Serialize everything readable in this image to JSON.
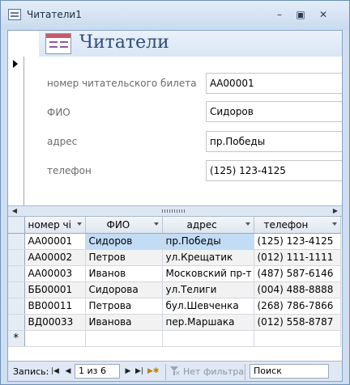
{
  "window": {
    "title": "Читатели1",
    "controls": {
      "minimize": "–",
      "restore": "▣",
      "close": "✕"
    }
  },
  "form": {
    "title": "Читатели",
    "fields": [
      {
        "label": "номер читательского билета",
        "value": "АА00001"
      },
      {
        "label": "ФИО",
        "value": "Сидоров"
      },
      {
        "label": "адрес",
        "value": "пр.Победы"
      },
      {
        "label": "телефон",
        "value": "(125) 123-4125"
      }
    ]
  },
  "datasheet": {
    "columns": [
      "номер чі",
      "ФИО",
      "адрес",
      "телефон"
    ],
    "rows": [
      [
        "АА00001",
        "Сидоров",
        "пр.Победы",
        "(125) 123-4125"
      ],
      [
        "АА00002",
        "Петров",
        "ул.Крещатик",
        "(012) 111-1111"
      ],
      [
        "АА00003",
        "Иванов",
        "Московский пр-т",
        "(487) 587-6146"
      ],
      [
        "ББ00001",
        "Сидорова",
        "ул.Телиги",
        "(004) 488-8888"
      ],
      [
        "ВВ00011",
        "Петрова",
        "бул.Шевченка",
        "(268) 786-7866"
      ],
      [
        "ВД00033",
        "Иванова",
        "пер.Маршака",
        "(012) 558-8787"
      ]
    ],
    "new_row_marker": "*"
  },
  "navigation": {
    "label": "Запись:",
    "position": "1 из 6",
    "filter_text": "Нет фильтра",
    "search_placeholder": "Поиск"
  },
  "colors": {
    "title_blue": "#2c4b7a",
    "selected_cell": "#c2dcf6",
    "frame": "#cfdef0"
  }
}
